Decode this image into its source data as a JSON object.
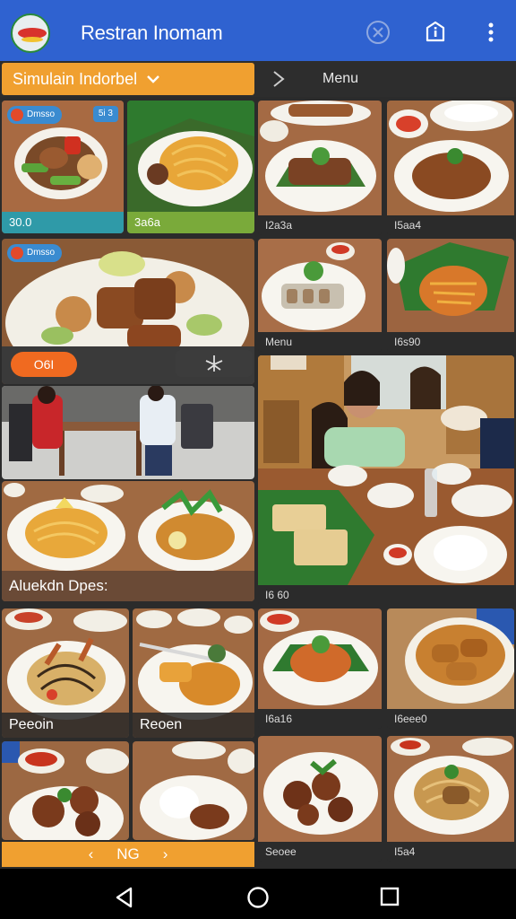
{
  "app": {
    "title": "Restran Inomam"
  },
  "toolbar": {
    "close_icon": "close-circle-icon",
    "info_icon": "info-icon",
    "more_icon": "more-vert-icon"
  },
  "filter": {
    "selected": "Simulain Indorbel",
    "menu_label": "Menu"
  },
  "tiles": {
    "t1": {
      "badge": "Dmsso",
      "corner": "5i 3",
      "caption": "30.0"
    },
    "t2": {
      "caption": "3a6a"
    },
    "t3": {
      "caption": "I2a3a"
    },
    "t4": {
      "caption": "I5aa4"
    },
    "t5": {
      "badge": "Dmsso",
      "pill_left": "O6I",
      "pill_right": "⌖"
    },
    "t6": {
      "caption": "Menu"
    },
    "t7": {
      "caption": "I6s90"
    },
    "t8": {
      "caption": "Aluekdn Dpes:"
    },
    "t9": {
      "caption": "I6 60"
    },
    "t10": {
      "caption": "Peeoin"
    },
    "t11": {
      "caption": "Reoen"
    },
    "t12": {
      "caption": "I6a16"
    },
    "t13": {
      "caption": "I6eee0"
    },
    "t14": {
      "caption": "Seoee"
    },
    "t15": {
      "caption": "I5a4"
    }
  },
  "pager": {
    "prev": "‹",
    "label": "NG",
    "next": "›"
  },
  "colors": {
    "appbar": "#2f62d0",
    "accent": "#f0a030",
    "teal": "#2f9aa8",
    "green": "#7aaa3a"
  }
}
